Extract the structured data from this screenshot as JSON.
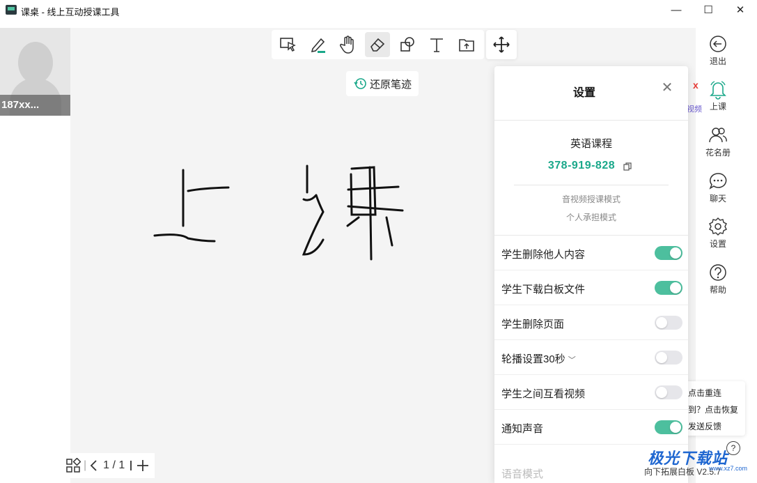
{
  "window": {
    "title": "课桌 - 线上互动授课工具",
    "minimize": "—",
    "maximize": "☐",
    "close": "✕"
  },
  "avatar": {
    "name": "187xx..."
  },
  "toolbar": {
    "tools": [
      "select-icon",
      "pen-icon",
      "hand-icon",
      "eraser-icon",
      "shapes-icon",
      "text-icon",
      "upload-folder-icon"
    ],
    "move": "move-icon",
    "restore_label": "还原笔迹"
  },
  "pager": {
    "label": "1 / 1"
  },
  "sidebar": {
    "items": [
      {
        "label": "退出"
      },
      {
        "label": "上课"
      },
      {
        "label": "花名册"
      },
      {
        "label": "聊天"
      },
      {
        "label": "设置"
      },
      {
        "label": "帮助"
      }
    ]
  },
  "settings": {
    "title": "设置",
    "course_name": "英语课程",
    "course_id": "378-919-828",
    "mode_1": "音视频授课模式",
    "mode_2": "个人承担模式",
    "rows": [
      {
        "label": "学生删除他人内容",
        "on": true
      },
      {
        "label": "学生下载白板文件",
        "on": true
      },
      {
        "label": "学生删除页面",
        "on": false
      },
      {
        "label": "轮播设置30秒",
        "on": false
      },
      {
        "label": "学生之间互看视频",
        "on": false
      },
      {
        "label": "通知声音",
        "on": true
      }
    ],
    "partial_row": "语音模式"
  },
  "popups": {
    "peek_x": "x",
    "peek_side": "视频",
    "reconnect": [
      "点击重连",
      "到？点击恢复",
      "发送反馈"
    ],
    "help": "?"
  },
  "footer": {
    "text": "向下拓展白板 V2.5.7"
  },
  "watermark": {
    "text": "极光下载站",
    "sub": "www.xz7.com"
  },
  "colors": {
    "accent": "#1aa88a",
    "toggle_on": "#4dbf9e",
    "toggle_off": "#e6e6ea"
  }
}
